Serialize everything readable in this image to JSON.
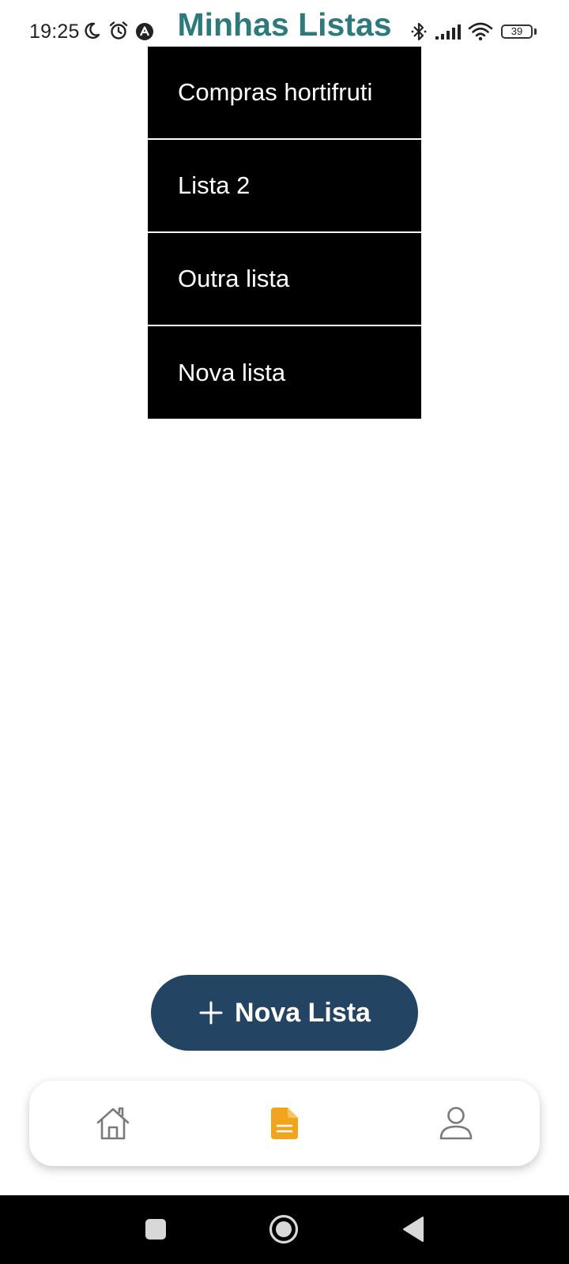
{
  "status_bar": {
    "time": "19:25",
    "battery_level": "39",
    "icons": [
      "moon-icon",
      "alarm-icon",
      "app-notification-icon",
      "bluetooth-icon",
      "signal-icon",
      "wifi-icon",
      "battery-icon"
    ]
  },
  "header": {
    "title": "Minhas Listas"
  },
  "lists": [
    {
      "label": "Compras hortifruti"
    },
    {
      "label": "Lista 2"
    },
    {
      "label": "Outra lista"
    },
    {
      "label": "Nova lista"
    }
  ],
  "new_list_button": {
    "label": "Nova Lista",
    "icon": "plus-icon",
    "color": "#234462"
  },
  "bottom_nav": {
    "items": [
      {
        "icon": "home-icon",
        "active": false
      },
      {
        "icon": "document-icon",
        "active": true
      },
      {
        "icon": "user-icon",
        "active": false
      }
    ],
    "active_color": "#f0a51c",
    "inactive_color": "#7a7a7a"
  },
  "system_nav": {
    "items": [
      "recent-apps-icon",
      "home-circle-icon",
      "back-icon"
    ]
  },
  "colors": {
    "title": "#2c7a7b",
    "list_background": "#000000",
    "list_text": "#ffffff"
  }
}
